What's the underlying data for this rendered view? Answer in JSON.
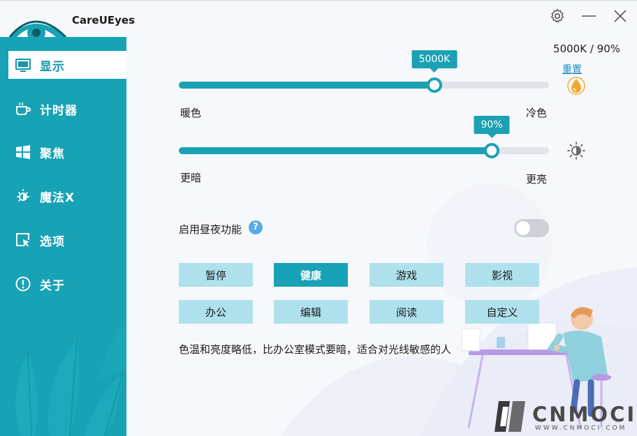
{
  "app": {
    "title": "CareUEyes"
  },
  "sidebar": {
    "items": [
      {
        "label": "显示",
        "icon": "monitor-icon",
        "active": true
      },
      {
        "label": "计时器",
        "icon": "coffee-cup-icon",
        "active": false
      },
      {
        "label": "聚焦",
        "icon": "windows-logo-icon",
        "active": false
      },
      {
        "label": "魔法X",
        "icon": "sun-moon-icon",
        "active": false
      },
      {
        "label": "选项",
        "icon": "cursor-square-icon",
        "active": false
      },
      {
        "label": "关于",
        "icon": "info-circle-icon",
        "active": false
      }
    ]
  },
  "display": {
    "readout": "5000K / 90%",
    "reset_label": "重置",
    "color_temp": {
      "tooltip": "5000K",
      "value": 0.69,
      "min_label": "暖色",
      "max_label": "冷色",
      "icon": "drop-icon"
    },
    "brightness": {
      "tooltip": "90%",
      "value": 0.845,
      "min_label": "更暗",
      "max_label": "更亮",
      "icon": "brightness-icon"
    },
    "day_night": {
      "label": "启用昼夜功能",
      "help": "?",
      "enabled": false
    }
  },
  "modes": [
    {
      "label": "暂停",
      "active": false
    },
    {
      "label": "健康",
      "active": true
    },
    {
      "label": "游戏",
      "active": false
    },
    {
      "label": "影视",
      "active": false
    },
    {
      "label": "办公",
      "active": false
    },
    {
      "label": "编辑",
      "active": false
    },
    {
      "label": "阅读",
      "active": false
    },
    {
      "label": "自定义",
      "active": false
    }
  ],
  "mode_description": "色温和亮度略低，比办公室模式要暗，适合对光线敏感的人",
  "watermark": {
    "text": "CNMOCI",
    "sub": "WWW.CNMOCI.COM"
  },
  "colors": {
    "accent": "#17a2b5",
    "mode_button": "#aee1ec",
    "reset_link": "#1f8fbf"
  }
}
